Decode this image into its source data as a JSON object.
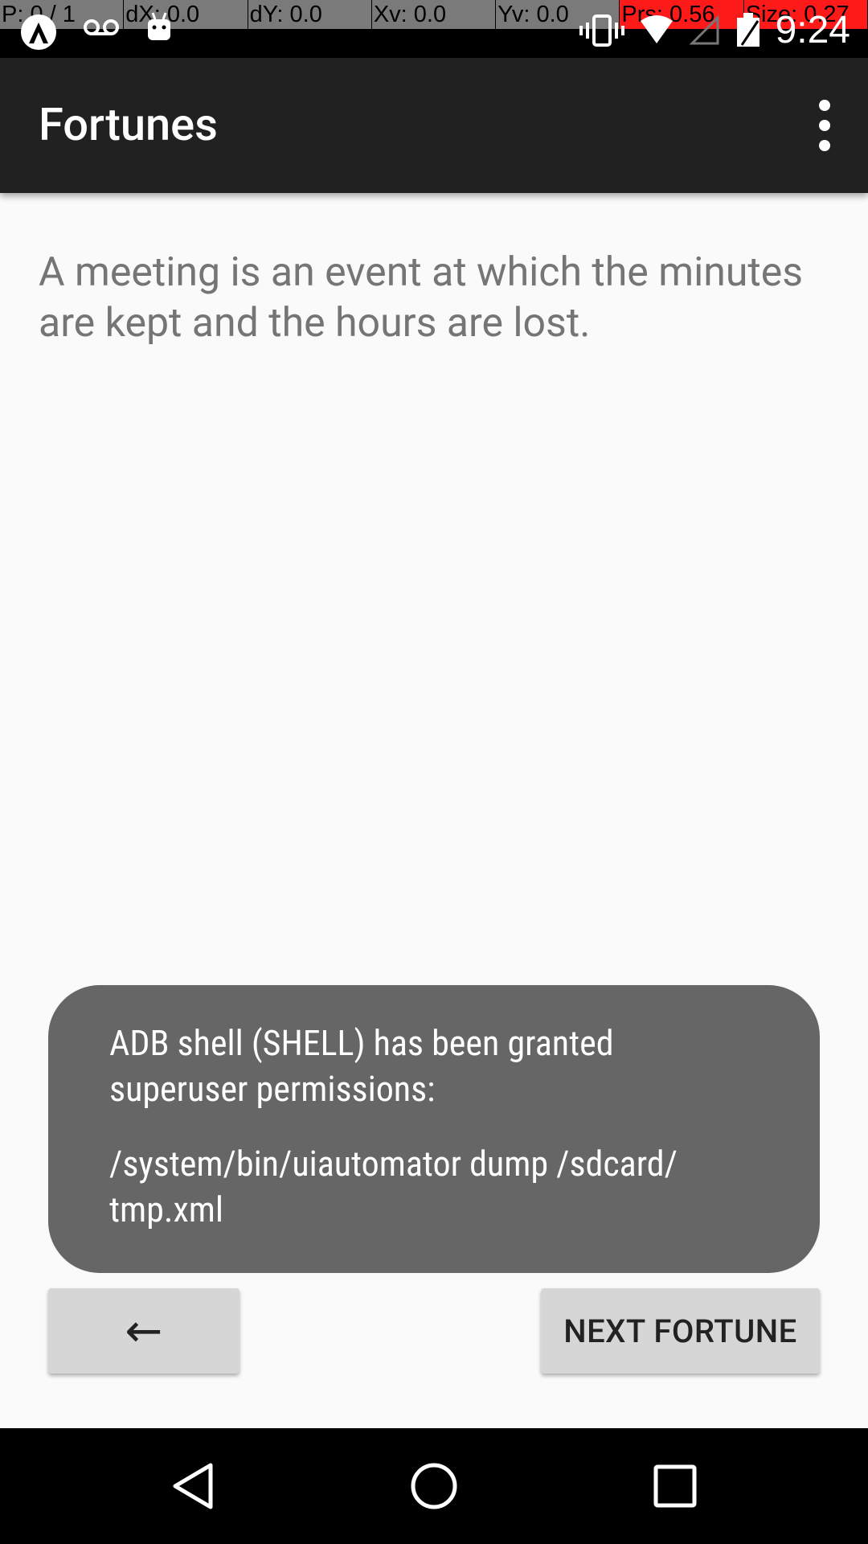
{
  "status_bar": {
    "debug": [
      {
        "text": "P: 0 / 1",
        "highlight": false
      },
      {
        "text": "dX: 0.0",
        "highlight": false
      },
      {
        "text": "dY: 0.0",
        "highlight": false
      },
      {
        "text": "Xv: 0.0",
        "highlight": false
      },
      {
        "text": "Yv: 0.0",
        "highlight": false
      },
      {
        "text": "Prs: 0.56",
        "highlight": true
      },
      {
        "text": "Size: 0.27",
        "highlight": true
      }
    ],
    "time": "9:24",
    "left_icons": [
      "app-icon",
      "voicemail-icon",
      "android-icon"
    ],
    "right_icons": [
      "vibrate-icon",
      "wifi-icon",
      "signal-icon",
      "battery-icon"
    ]
  },
  "app_bar": {
    "title": "Fortunes",
    "menu_icon": "more-vert-icon"
  },
  "fortune": {
    "text": "A meeting is an event at which the minutes are kept and the hours are lost."
  },
  "toast": {
    "line1": "ADB shell (SHELL) has been granted\nsuperuser permissions:",
    "line2": "/system/bin/uiautomator dump /sdcard/\ntmp.xml"
  },
  "buttons": {
    "back_label": "←",
    "next_label": "NEXT FORTUNE"
  },
  "nav_bar": {
    "icons": [
      "back-triangle-icon",
      "home-circle-icon",
      "recents-square-icon"
    ]
  },
  "colors": {
    "app_bar": "#212121",
    "background": "#fafafa",
    "toast": "#666666",
    "button": "#d6d6d6",
    "highlight": "#ff1a1a"
  }
}
